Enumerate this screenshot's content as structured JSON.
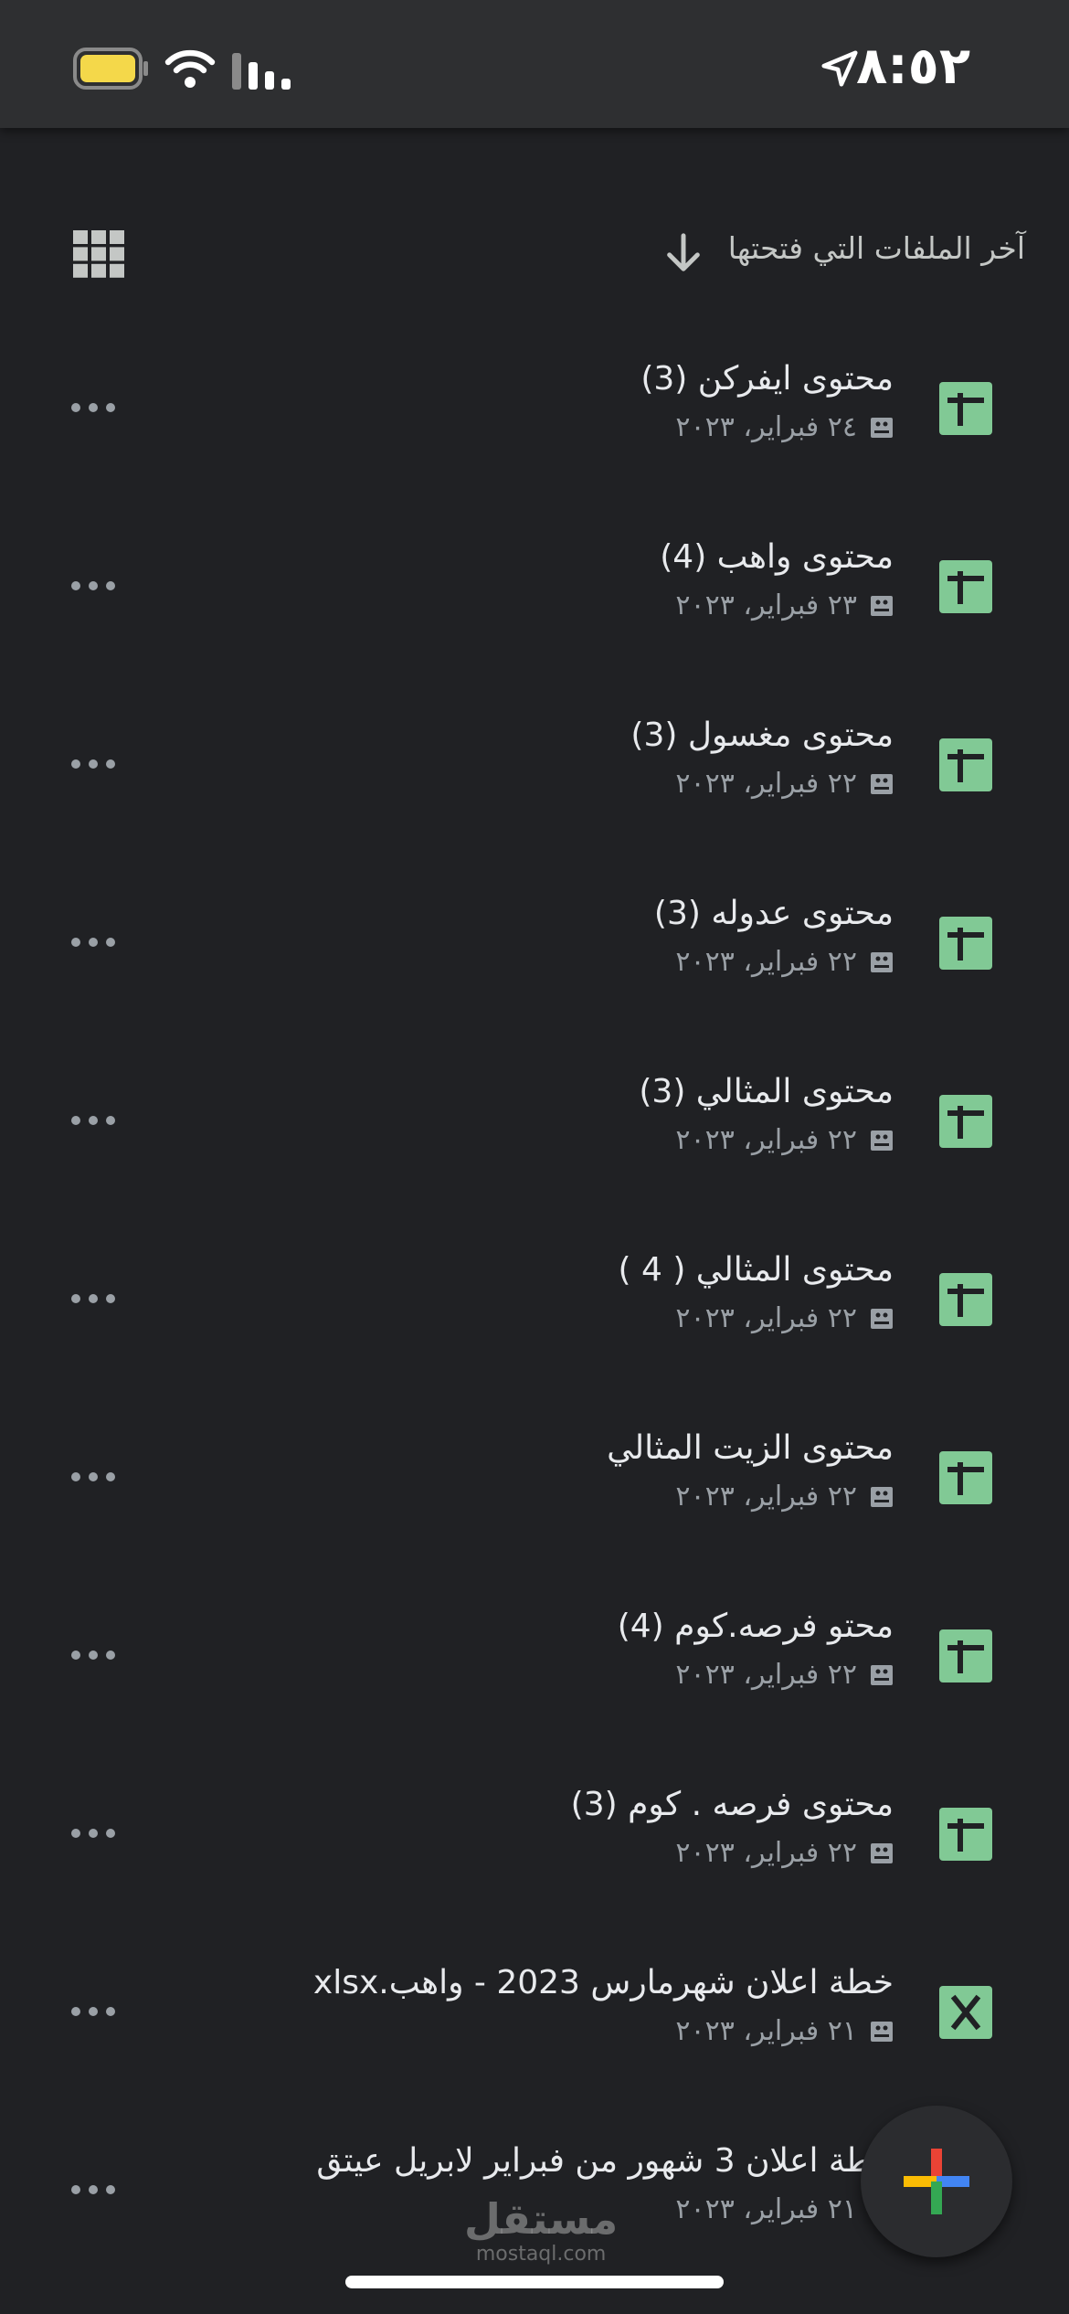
{
  "status_bar": {
    "time": "٨:٥٢"
  },
  "header": {
    "sort_label": "آخر الملفات التي فتحتها"
  },
  "files": [
    {
      "title": "محتوى ايفركن (3)",
      "date": "٢٤ فبراير، ٢٠٢٣",
      "type": "sheets"
    },
    {
      "title": "محتوى واهب (4)",
      "date": "٢٣ فبراير، ٢٠٢٣",
      "type": "sheets"
    },
    {
      "title": "محتوى مغسول (3)",
      "date": "٢٢ فبراير، ٢٠٢٣",
      "type": "sheets"
    },
    {
      "title": "محتوى عدوله (3)",
      "date": "٢٢ فبراير، ٢٠٢٣",
      "type": "sheets"
    },
    {
      "title": "محتوى المثالي (3)",
      "date": "٢٢ فبراير، ٢٠٢٣",
      "type": "sheets"
    },
    {
      "title": "محتوى المثالي ( 4 )",
      "date": "٢٢ فبراير، ٢٠٢٣",
      "type": "sheets"
    },
    {
      "title": "محتوى الزيت المثالي",
      "date": "٢٢ فبراير، ٢٠٢٣",
      "type": "sheets"
    },
    {
      "title": "محتو فرصه.كوم (4)",
      "date": "٢٢ فبراير، ٢٠٢٣",
      "type": "sheets"
    },
    {
      "title": "محتوى فرصه . كوم (3)",
      "date": "٢٢ فبراير، ٢٠٢٣",
      "type": "sheets"
    },
    {
      "title": "خطة اعلان شهرمارس 2023 - واهب.xlsx",
      "date": "٢١ فبراير، ٢٠٢٣",
      "type": "excel"
    },
    {
      "title": "خطة اعلان 3 شهور من فبراير لابريل عيتق",
      "date": "٢١ فبراير، ٢٠٢٣",
      "type": "sheets"
    }
  ],
  "icons": {
    "sheets": "sheets-file-icon",
    "excel": "excel-file-icon",
    "more": "more-options-icon",
    "fab": "new-file-plus-icon"
  },
  "colors": {
    "background": "#202124",
    "sheets_green": "#81c995",
    "fab_red": "#ea4335",
    "fab_blue": "#4285f4",
    "fab_yellow": "#fbbc04",
    "fab_green": "#34a853"
  },
  "watermark": {
    "main": "مستقل",
    "sub": "mostaql.com"
  }
}
